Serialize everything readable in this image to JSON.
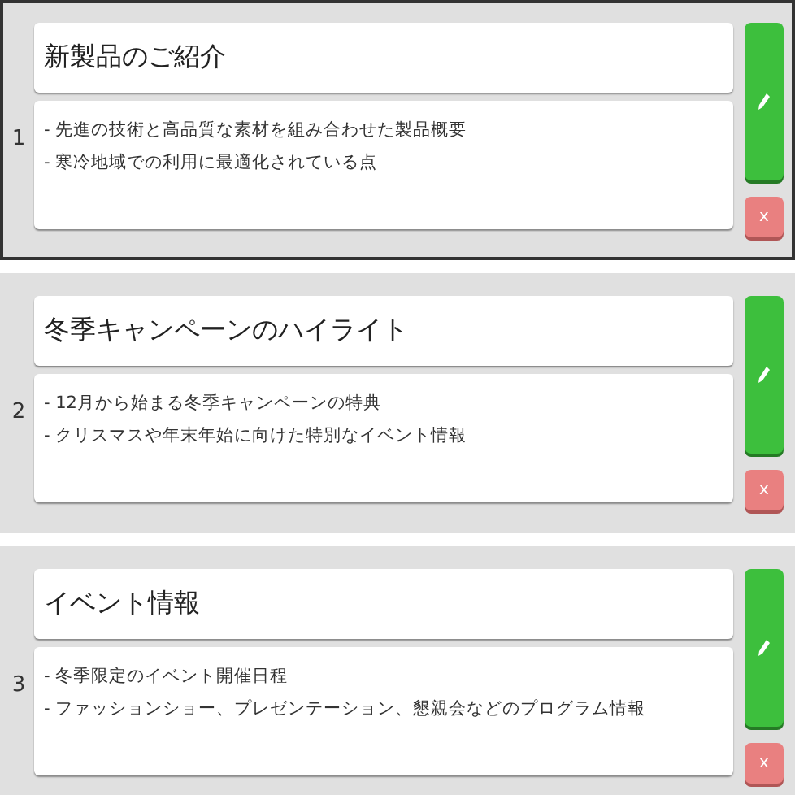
{
  "cards": [
    {
      "number": "1",
      "selected": true,
      "title": "新製品のご紹介",
      "lines": [
        "- 先進の技術と高品質な素材を組み合わせた製品概要",
        "- 寒冷地域での利用に最適化されている点"
      ],
      "delete_label": "x"
    },
    {
      "number": "2",
      "selected": false,
      "title": "冬季キャンペーンのハイライト",
      "lines": [
        "- 12月から始まる冬季キャンペーンの特典",
        "- クリスマスや年末年始に向けた特別なイベント情報"
      ],
      "delete_label": "x"
    },
    {
      "number": "3",
      "selected": false,
      "title": "イベント情報",
      "lines": [
        "- 冬季限定のイベント開催日程",
        "- ファッションショー、プレゼンテーション、懇親会などのプログラム情報"
      ],
      "delete_label": "x"
    }
  ]
}
